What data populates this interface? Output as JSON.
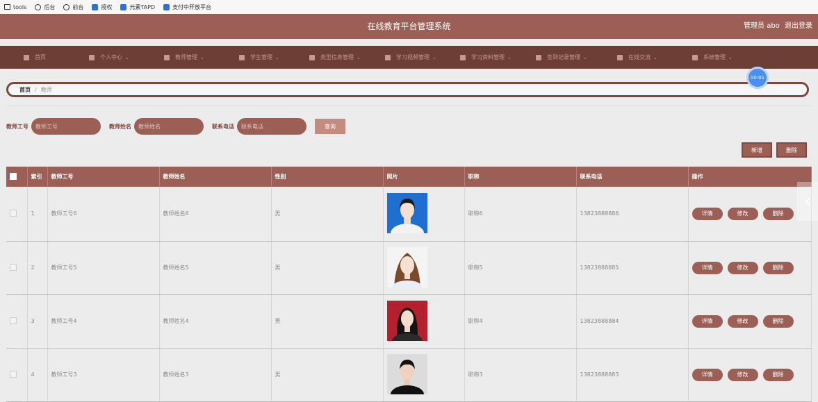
{
  "bookmarks": [
    {
      "label": "tools",
      "icon": "folder-icon"
    },
    {
      "label": "后台",
      "icon": "globe-icon"
    },
    {
      "label": "前台",
      "icon": "globe-icon"
    },
    {
      "label": "授权",
      "icon": "app-icon"
    },
    {
      "label": "元素TAPD",
      "icon": "app-icon"
    },
    {
      "label": "支付中开放平台",
      "icon": "app-icon"
    }
  ],
  "header": {
    "title": "在线教育平台管理系统",
    "user": "管理员 abo",
    "logout": "退出登录"
  },
  "nav": [
    {
      "label": "首页",
      "icon": "home-icon",
      "chev": ""
    },
    {
      "label": "个人中心",
      "icon": "user-icon",
      "chev": "⌄"
    },
    {
      "label": "教师管理",
      "icon": "grid-icon",
      "chev": "⌄"
    },
    {
      "label": "学生管理",
      "icon": "grid-icon",
      "chev": "⌄"
    },
    {
      "label": "类型信息管理",
      "icon": "grid-icon",
      "chev": "⌄"
    },
    {
      "label": "学习视频管理",
      "icon": "filter-icon",
      "chev": "⌄"
    },
    {
      "label": "学习资料管理",
      "icon": "upload-icon",
      "chev": "⌄"
    },
    {
      "label": "签到记录管理",
      "icon": "user-icon",
      "chev": "⌄"
    },
    {
      "label": "在线交流",
      "icon": "list-icon",
      "chev": "⌄"
    },
    {
      "label": "系统管理",
      "icon": "db-icon",
      "chev": "⌄"
    }
  ],
  "breadcrumb": {
    "home": "首页",
    "sep": "/",
    "current": "教师"
  },
  "timer": "00:01",
  "search": {
    "no_label": "教师工号",
    "no_placeholder": "教师工号",
    "name_label": "教师姓名",
    "name_placeholder": "教师姓名",
    "phone_label": "联系电话",
    "phone_placeholder": "联系电话",
    "query": "查询"
  },
  "actions": {
    "add": "新增",
    "delete": "删除"
  },
  "table": {
    "headers": [
      "",
      "索引",
      "教师工号",
      "教师姓名",
      "性别",
      "照片",
      "职称",
      "联系电话",
      "操作"
    ],
    "op_labels": {
      "detail": "详情",
      "edit": "修改",
      "delete": "删除"
    },
    "rows": [
      {
        "index": "1",
        "no": "教师工号6",
        "name": "教师姓名6",
        "gender": "男",
        "title": "职称6",
        "phone": "13823888886",
        "photo": "female-portrait-blue-bg"
      },
      {
        "index": "2",
        "no": "教师工号5",
        "name": "教师姓名5",
        "gender": "男",
        "title": "职称5",
        "phone": "13823888885",
        "photo": "female-portrait-white-bg"
      },
      {
        "index": "3",
        "no": "教师工号4",
        "name": "教师姓名4",
        "gender": "男",
        "title": "职称4",
        "phone": "13823888884",
        "photo": "female-portrait-red-bg"
      },
      {
        "index": "4",
        "no": "教师工号3",
        "name": "教师姓名3",
        "gender": "男",
        "title": "职称3",
        "phone": "13823888883",
        "photo": "male-portrait-gray-bg"
      }
    ]
  },
  "colors": {
    "primary": "#9b5f55",
    "nav": "#6b3e36",
    "accent": "#4a8ff0"
  }
}
